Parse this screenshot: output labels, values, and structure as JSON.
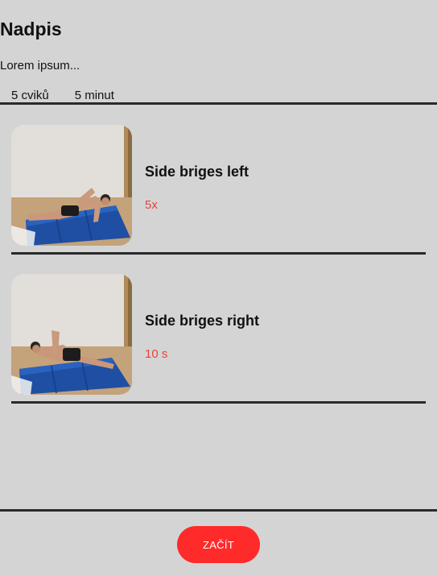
{
  "header": {
    "title": "Nadpis",
    "subtitle": "Lorem ipsum...",
    "exercise_count": "5 cviků",
    "duration": "5 minut"
  },
  "exercises": [
    {
      "name": "Side briges left",
      "amount": "5x",
      "image_icon": "exercise-photo-side-bridge-left"
    },
    {
      "name": "Side briges right",
      "amount": "10 s",
      "image_icon": "exercise-photo-side-bridge-right"
    }
  ],
  "footer": {
    "start_label": "ZAČÍT"
  },
  "colors": {
    "background": "#d4d4d4",
    "accent": "#ff2a2a",
    "amount_text": "#e8433a",
    "divider": "#2a2a2a"
  }
}
